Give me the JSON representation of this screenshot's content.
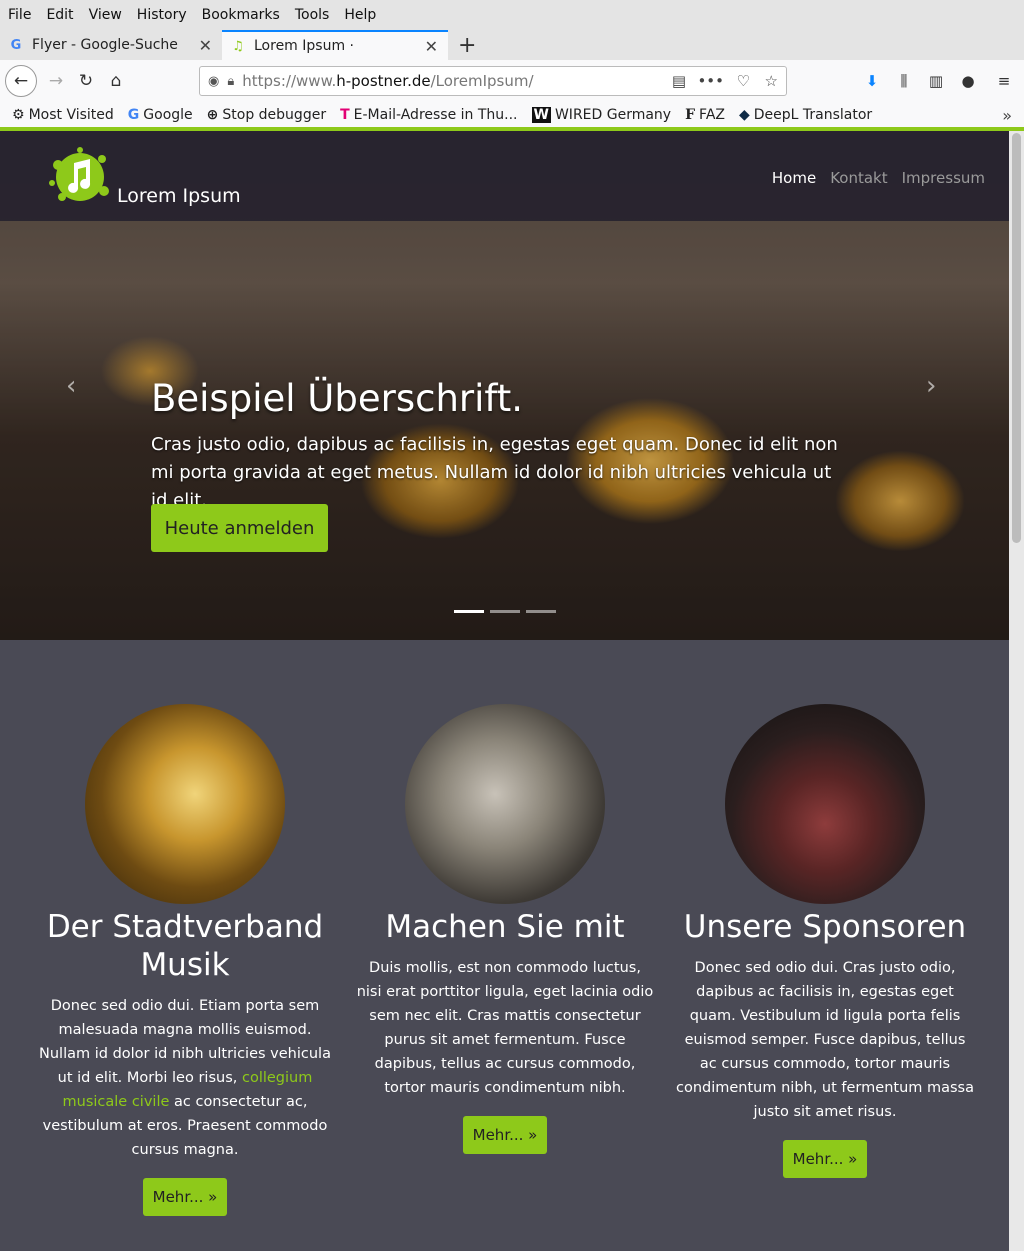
{
  "menubar": [
    "File",
    "Edit",
    "View",
    "History",
    "Bookmarks",
    "Tools",
    "Help"
  ],
  "tabs": [
    {
      "title": "Flyer - Google-Suche",
      "favicon": "G"
    },
    {
      "title": "Lorem Ipsum ·",
      "favicon": "♫"
    }
  ],
  "url": {
    "prefix": "https://www.",
    "domain": "h-postner.de",
    "path": "/LoremIpsum/"
  },
  "bookmarks": [
    {
      "icon": "⚙",
      "label": "Most Visited"
    },
    {
      "icon": "G",
      "label": "Google"
    },
    {
      "icon": "⊕",
      "label": "Stop debugger"
    },
    {
      "icon": "T",
      "label": "E-Mail-Adresse in Thu..."
    },
    {
      "icon": "W",
      "label": "WIRED Germany"
    },
    {
      "icon": "F",
      "label": "FAZ"
    },
    {
      "icon": "◆",
      "label": "DeepL Translator"
    }
  ],
  "site": {
    "brand": "Lorem Ipsum",
    "nav": [
      "Home",
      "Kontakt",
      "Impressum"
    ],
    "hero": {
      "title": "Beispiel Überschrift.",
      "text": "Cras justo odio, dapibus ac facilisis in, egestas eget quam. Donec id elit non mi porta gravida at eget metus. Nullam id dolor id nibh ultricies vehicula ut id elit.",
      "button": "Heute anmelden"
    },
    "columns": [
      {
        "title": "Der Stadtverband Musik",
        "text_before": "Donec sed odio dui. Etiam porta sem malesuada magna mollis euismod. Nullam id dolor id nibh ultricies vehicula ut id elit. Morbi leo risus,",
        "link": "collegium musicale civile",
        "text_after": "ac consectetur ac, vestibulum at eros. Praesent commodo cursus magna.",
        "button": "Mehr... »"
      },
      {
        "title": "Machen Sie mit",
        "text": "Duis mollis, est non commodo luctus, nisi erat porttitor ligula, eget lacinia odio sem nec elit. Cras mattis consectetur purus sit amet fermentum. Fusce dapibus, tellus ac cursus commodo, tortor mauris condimentum nibh.",
        "button": "Mehr... »"
      },
      {
        "title": "Unsere Sponsoren",
        "text": "Donec sed odio dui. Cras justo odio, dapibus ac facilisis in, egestas eget quam. Vestibulum id ligula porta felis euismod semper. Fusce dapibus, tellus ac cursus commodo, tortor mauris condimentum nibh, ut fermentum massa justo sit amet risus.",
        "button": "Mehr... »"
      }
    ]
  }
}
